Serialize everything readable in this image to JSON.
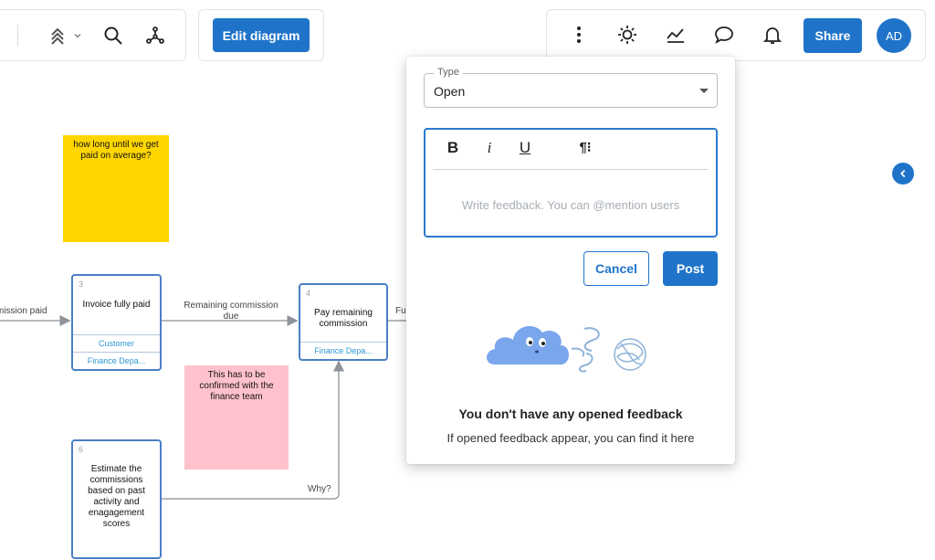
{
  "toolbar": {
    "edit_label": "Edit diagram",
    "share_label": "Share",
    "avatar_initials": "AD",
    "accent": "#1f74c9",
    "icons_left": [
      "layers-up-icon",
      "chevron-down-icon",
      "search-icon",
      "share-nodes-icon"
    ],
    "icons_right": [
      "more-vertical-icon",
      "sun-icon",
      "chart-line-icon",
      "comment-icon",
      "bell-icon"
    ]
  },
  "canvas": {
    "stickies": [
      {
        "text": "how long until we get paid on average?",
        "color": "#ffd600"
      },
      {
        "text": "This has to be confirmed with the finance team",
        "color": "#ffc2cc"
      }
    ],
    "nodes": [
      {
        "num": "3",
        "title": "Invoice fully paid",
        "lanes": [
          "Customer",
          "Finance Depa..."
        ]
      },
      {
        "num": "4",
        "title": "Pay remaining commission",
        "lanes": [
          "Finance Depa..."
        ]
      },
      {
        "num": "6",
        "title": "Estimate the commissions based on past activity and enagagement scores",
        "lanes": []
      }
    ],
    "edge_labels": [
      "mission paid",
      "Remaining commission due",
      "Fu",
      "Why?"
    ]
  },
  "feedback_panel": {
    "type_label": "Type",
    "type_value": "Open",
    "format_buttons": [
      "B",
      "i",
      "U",
      "¶⁝"
    ],
    "placeholder": "Write feedback. You can @mention users",
    "cancel_label": "Cancel",
    "post_label": "Post",
    "empty_title": "You don't have any opened feedback",
    "empty_subtitle": "If opened feedback appear, you can find it here"
  }
}
